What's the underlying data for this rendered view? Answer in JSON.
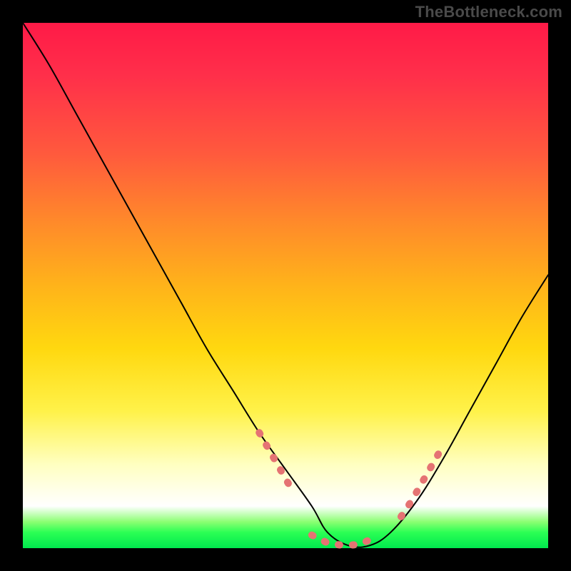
{
  "watermark": "TheBottleneck.com",
  "chart_data": {
    "type": "line",
    "title": "",
    "xlabel": "",
    "ylabel": "",
    "xlim": [
      0,
      100
    ],
    "ylim": [
      0,
      100
    ],
    "grid": false,
    "legend": false,
    "background_gradient": {
      "direction": "vertical",
      "stops": [
        {
          "pos": 0,
          "color": "#ff1a47"
        },
        {
          "pos": 50,
          "color": "#ffb31a"
        },
        {
          "pos": 75,
          "color": "#fff24a"
        },
        {
          "pos": 92,
          "color": "#ffffff"
        },
        {
          "pos": 100,
          "color": "#00e84e"
        }
      ]
    },
    "series": [
      {
        "name": "bottleneck-curve",
        "color": "#000000",
        "x": [
          0,
          5,
          10,
          15,
          20,
          25,
          30,
          35,
          40,
          45,
          50,
          55,
          58,
          62,
          66,
          70,
          75,
          80,
          85,
          90,
          95,
          100
        ],
        "y": [
          100,
          92,
          83,
          74,
          65,
          56,
          47,
          38,
          30,
          22,
          15,
          8,
          3,
          0.5,
          0.5,
          3,
          9,
          17,
          26,
          35,
          44,
          52
        ]
      }
    ],
    "markers": {
      "name": "highlight-dots",
      "color": "#e57373",
      "segments": [
        {
          "x": [
            45,
            47,
            49,
            51
          ],
          "y": [
            22,
            18.5,
            15,
            11.5
          ]
        },
        {
          "x": [
            55,
            58,
            61,
            64,
            67
          ],
          "y": [
            2.5,
            1,
            0.5,
            0.7,
            2
          ]
        },
        {
          "x": [
            72,
            74,
            76,
            78,
            80
          ],
          "y": [
            6,
            9,
            12.5,
            16,
            19.5
          ]
        }
      ]
    }
  }
}
